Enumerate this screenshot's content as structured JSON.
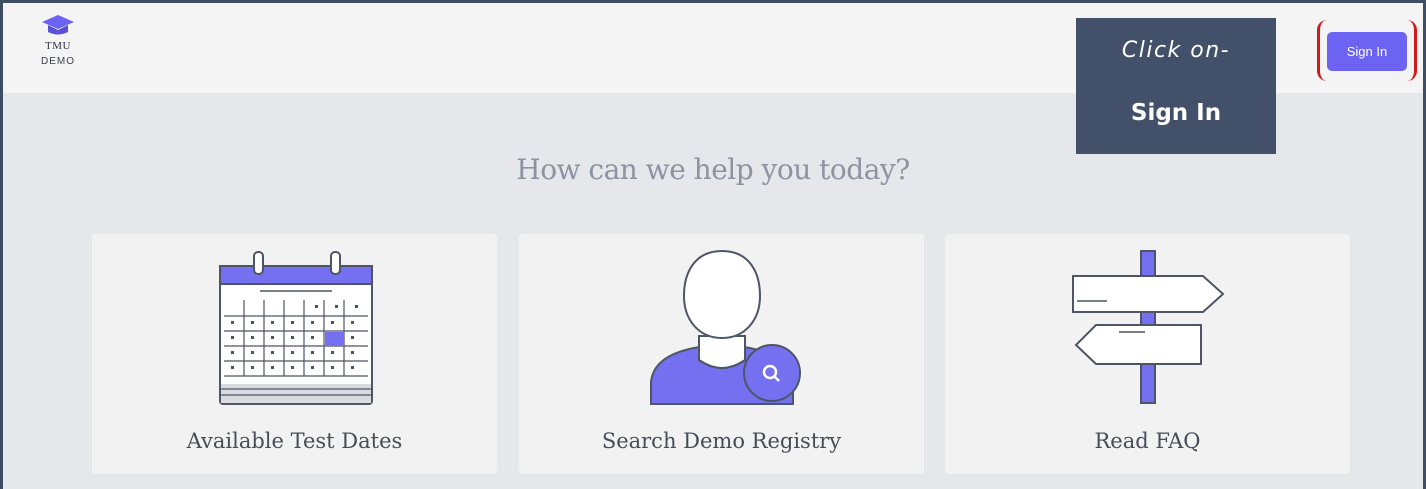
{
  "app": {
    "logo_text": "TMU",
    "logo_subtitle": "DEMO"
  },
  "header": {
    "signin_label": "Sign In"
  },
  "callout": {
    "line1": "Click on-",
    "line2": "Sign In"
  },
  "main": {
    "headline": "How can we help you today?",
    "cards": [
      {
        "label": "Available Test Dates",
        "icon": "calendar-icon"
      },
      {
        "label": "Search Demo Registry",
        "icon": "person-search-icon"
      },
      {
        "label": "Read FAQ",
        "icon": "signpost-icon"
      }
    ]
  },
  "colors": {
    "accent": "#6c63f2",
    "callout_bg": "#425069",
    "highlight": "#d0191b",
    "page_bg": "#e6e7ea"
  }
}
